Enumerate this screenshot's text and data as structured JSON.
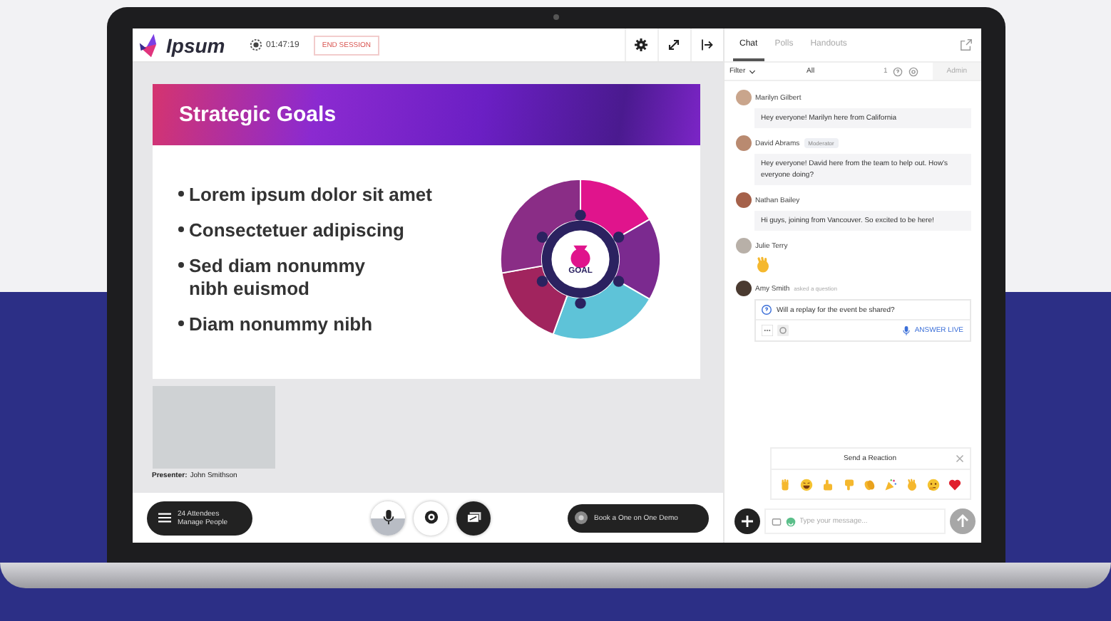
{
  "app": {
    "logo": "Ipsum",
    "timer": "01:47:19",
    "end_button": "END SESSION"
  },
  "slide": {
    "title": "Strategic Goals",
    "bullets": [
      {
        "lines": [
          "Lorem ipsum dolor sit amet"
        ]
      },
      {
        "lines": [
          "Consectetuer adipiscing"
        ]
      },
      {
        "lines": [
          "Sed diam nonummy",
          "nibh euismod"
        ]
      },
      {
        "lines": [
          "Diam nonummy nibh"
        ]
      }
    ],
    "graphic_label": "GOAL"
  },
  "presenter": {
    "label": "Presenter:",
    "name": "John Smithson"
  },
  "bottom_bar": {
    "attendees": "24 Attendees",
    "manage": "Manage People",
    "demo_button": "Book a One on One Demo"
  },
  "chat": {
    "tabs": [
      {
        "label": "Chat",
        "selected": true
      },
      {
        "label": "Polls",
        "selected": false
      },
      {
        "label": "Handouts",
        "selected": false
      }
    ],
    "filter": "Filter",
    "all": "All",
    "count": "1",
    "admin": "Admin",
    "messages": [
      {
        "kind": "text",
        "author": "Marilyn Gilbert",
        "text": "Hey everyone! Marilyn here from California"
      },
      {
        "kind": "text",
        "author": "David Abrams",
        "badge": "Moderator",
        "text": "Hey everyone! David here from the team to help out. How's everyone doing?"
      },
      {
        "kind": "text",
        "author": "Nathan Bailey",
        "text": "Hi guys, joining from Vancouver. So excited to be here!"
      },
      {
        "kind": "wave",
        "author": "Julie Terry"
      },
      {
        "kind": "question",
        "author": "Amy Smith",
        "action": "asked a question",
        "text": "Will a replay for the event be shared?",
        "answer_button": "ANSWER LIVE"
      }
    ],
    "reactions": {
      "title": "Send a Reaction",
      "items": [
        {
          "kind": "hand"
        },
        {
          "kind": "laugh"
        },
        {
          "kind": "thumbs-up"
        },
        {
          "kind": "thumbs-down"
        },
        {
          "kind": "clap"
        },
        {
          "kind": "party"
        },
        {
          "kind": "wave"
        },
        {
          "kind": "thinking"
        },
        {
          "kind": "heart"
        }
      ]
    },
    "input": {
      "placeholder": "Type your message..."
    }
  }
}
